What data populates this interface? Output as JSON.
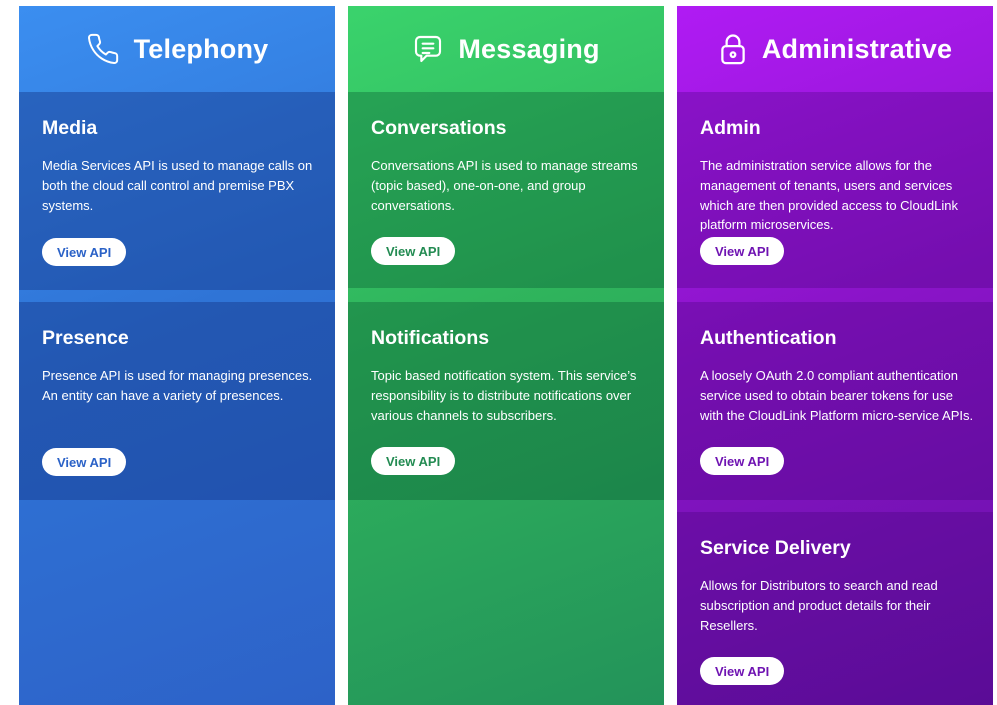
{
  "columns": [
    {
      "title": "Telephony",
      "icon": "phone-icon",
      "cards": [
        {
          "title": "Media",
          "description": "Media Services API is used to manage calls on both the cloud call control and premise PBX systems.",
          "button": "View API"
        },
        {
          "title": "Presence",
          "description": "Presence API is used for managing presences. An entity can have a variety of presences.",
          "button": "View API"
        }
      ]
    },
    {
      "title": "Messaging",
      "icon": "message-icon",
      "cards": [
        {
          "title": "Conversations",
          "description": "Conversations API is used to manage streams (topic based), one-on-one, and group conversations.",
          "button": "View API"
        },
        {
          "title": "Notifications",
          "description": "Topic based notification system. This service’s responsibility is to distribute notifications over various channels to subscribers.",
          "button": "View API"
        }
      ]
    },
    {
      "title": "Administrative",
      "icon": "lock-icon",
      "cards": [
        {
          "title": "Admin",
          "description": "The administration service allows for the management of tenants, users and services which are then provided access to CloudLink platform microservices.",
          "button": "View API"
        },
        {
          "title": "Authentication",
          "description": "A loosely OAuth 2.0 compliant authentication service used to obtain bearer tokens for use with the CloudLink Platform micro-service APIs.",
          "button": "View API"
        },
        {
          "title": "Service Delivery",
          "description": "Allows for Distributors to search and read subscription and product details for their Resellers.",
          "button": "View API"
        }
      ]
    }
  ],
  "colors": {
    "telephony": "#2f74d6",
    "messaging": "#2fb35c",
    "administrative": "#8a14c8"
  }
}
